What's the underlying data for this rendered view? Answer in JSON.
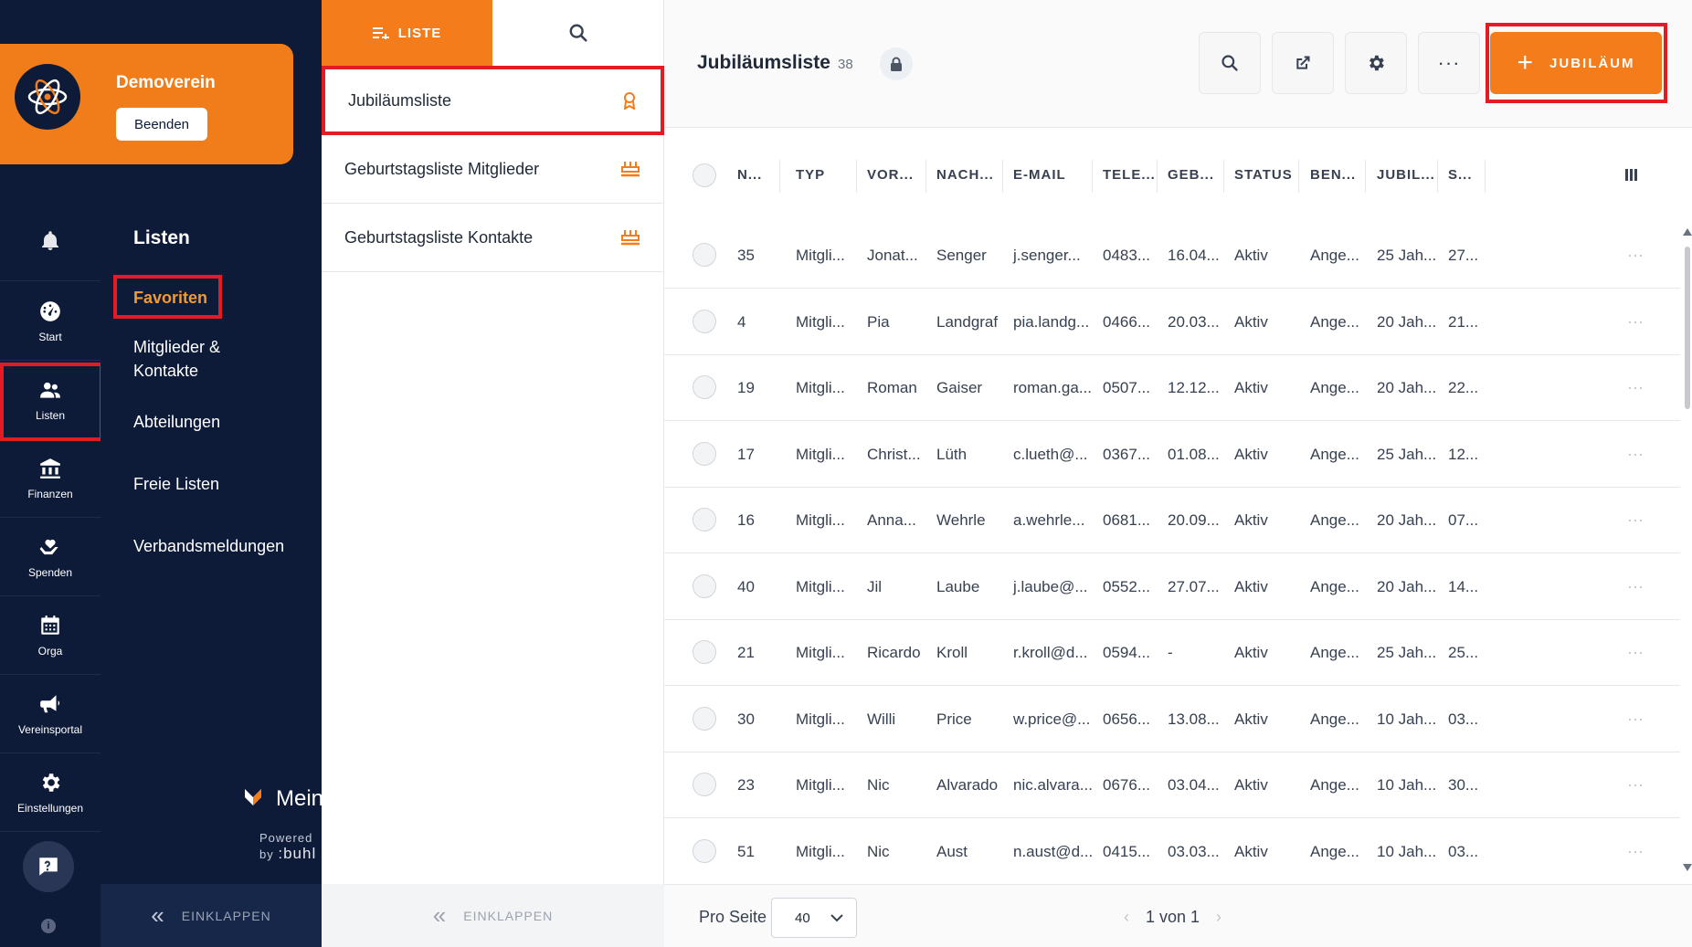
{
  "rail": {
    "items": [
      {
        "label": "Start",
        "icon": "dashboard-icon"
      },
      {
        "label": "Listen",
        "icon": "people-icon"
      },
      {
        "label": "Finanzen",
        "icon": "bank-icon"
      },
      {
        "label": "Spenden",
        "icon": "heart-hand-icon"
      },
      {
        "label": "Orga",
        "icon": "calendar-icon"
      },
      {
        "label": "Vereinsportal",
        "icon": "megaphone-icon"
      },
      {
        "label": "Einstellungen",
        "icon": "gear-icon"
      }
    ],
    "info": "i"
  },
  "club": {
    "name": "Demoverein",
    "end_label": "Beenden"
  },
  "nav": {
    "title": "Listen",
    "items": [
      "Favoriten",
      "Mitglieder &\nKontakte",
      "Abteilungen",
      "Freie Listen",
      "Verbandsmeldungen"
    ],
    "collapse": "EINKLAPPEN"
  },
  "brand": {
    "name": "MeinVerein",
    "powered": "Powered by",
    "by": ":buhl"
  },
  "lists": {
    "tab_label": "LISTE",
    "items": [
      {
        "label": "Jubiläumsliste",
        "icon": "award-icon"
      },
      {
        "label": "Geburtstagsliste Mitglieder",
        "icon": "cake-icon"
      },
      {
        "label": "Geburtstagsliste Kontakte",
        "icon": "cake-icon"
      }
    ],
    "collapse": "EINKLAPPEN"
  },
  "main": {
    "title": "Jubiläumsliste",
    "count": "38",
    "add_label": "JUBILÄUM",
    "columns": [
      "N...",
      "TYP",
      "VOR...",
      "NACH...",
      "E-MAIL",
      "TELE...",
      "GEB...",
      "STATUS",
      "BEN...",
      "JUBIL...",
      "S..."
    ],
    "rows": [
      [
        "35",
        "Mitgli...",
        "Jonat...",
        "Senger",
        "j.senger...",
        "0483...",
        "16.04...",
        "Aktiv",
        "Ange...",
        "25 Jah...",
        "27..."
      ],
      [
        "4",
        "Mitgli...",
        "Pia",
        "Landgraf",
        "pia.landg...",
        "0466...",
        "20.03...",
        "Aktiv",
        "Ange...",
        "20 Jah...",
        "21..."
      ],
      [
        "19",
        "Mitgli...",
        "Roman",
        "Gaiser",
        "roman.ga...",
        "0507...",
        "12.12...",
        "Aktiv",
        "Ange...",
        "20 Jah...",
        "22..."
      ],
      [
        "17",
        "Mitgli...",
        "Christ...",
        "Lüth",
        "c.lueth@...",
        "0367...",
        "01.08...",
        "Aktiv",
        "Ange...",
        "25 Jah...",
        "12..."
      ],
      [
        "16",
        "Mitgli...",
        "Anna...",
        "Wehrle",
        "a.wehrle...",
        "0681...",
        "20.09...",
        "Aktiv",
        "Ange...",
        "20 Jah...",
        "07..."
      ],
      [
        "40",
        "Mitgli...",
        "Jil",
        "Laube",
        "j.laube@...",
        "0552...",
        "27.07...",
        "Aktiv",
        "Ange...",
        "20 Jah...",
        "14..."
      ],
      [
        "21",
        "Mitgli...",
        "Ricardo",
        "Kroll",
        "r.kroll@d...",
        "0594...",
        "-",
        "Aktiv",
        "Ange...",
        "25 Jah...",
        "25..."
      ],
      [
        "30",
        "Mitgli...",
        "Willi",
        "Price",
        "w.price@...",
        "0656...",
        "13.08...",
        "Aktiv",
        "Ange...",
        "10 Jah...",
        "03..."
      ],
      [
        "23",
        "Mitgli...",
        "Nic",
        "Alvarado",
        "nic.alvara...",
        "0676...",
        "03.04...",
        "Aktiv",
        "Ange...",
        "10 Jah...",
        "30..."
      ],
      [
        "51",
        "Mitgli...",
        "Nic",
        "Aust",
        "n.aust@d...",
        "0415...",
        "03.03...",
        "Aktiv",
        "Ange...",
        "10 Jah...",
        "03..."
      ]
    ],
    "more": "⋯"
  },
  "footer": {
    "per_page_label": "Pro Seite",
    "per_page_value": "40",
    "pager": "1 von 1"
  },
  "colors": {
    "accent": "#f47c1b",
    "navy": "#0d1b39",
    "highlight": "#e31b23"
  }
}
